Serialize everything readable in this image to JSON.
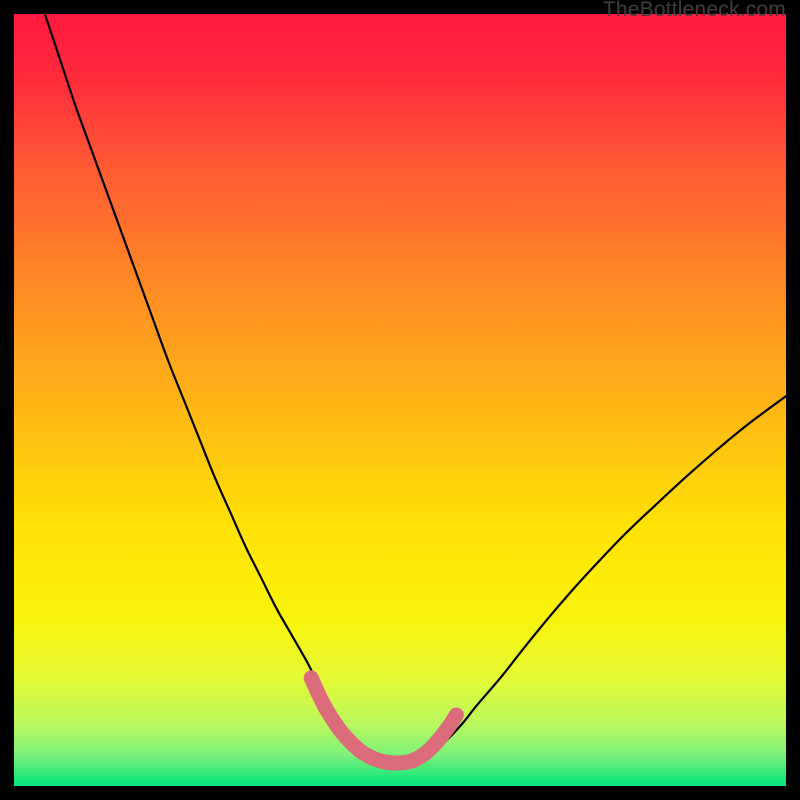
{
  "attribution": "TheBottleneck.com",
  "colors": {
    "black": "#000000",
    "curve": "#000000",
    "pink_highlight": "#dc6b7c",
    "gradient_top": "#ff193f",
    "gradient_mid": "#ffd400",
    "gradient_bot": "#00e57a"
  },
  "chart_data": {
    "type": "line",
    "title": "",
    "xlabel": "",
    "ylabel": "",
    "xlim": [
      0,
      100
    ],
    "ylim": [
      0,
      100
    ],
    "series": [
      {
        "name": "bottleneck-curve",
        "x": [
          4,
          6,
          8,
          10,
          12,
          14,
          16,
          18,
          20,
          22,
          24,
          26,
          28,
          30,
          32,
          34,
          36,
          38,
          39.5,
          41,
          42.5,
          44,
          45.5,
          47,
          48.5,
          50,
          52,
          54,
          56,
          58,
          60,
          63,
          66,
          69,
          72,
          75,
          79,
          83,
          87,
          91,
          95,
          100
        ],
        "y": [
          100,
          94,
          88,
          82.5,
          77,
          71.5,
          66,
          60.5,
          55,
          50,
          45,
          40,
          35.5,
          31,
          27,
          23,
          19.5,
          16,
          13,
          10.5,
          8.2,
          6.2,
          4.7,
          3.5,
          3,
          3,
          3.3,
          4.3,
          5.9,
          8,
          10.5,
          14,
          17.8,
          21.5,
          25,
          28.3,
          32.5,
          36.3,
          40,
          43.5,
          46.8,
          50.5
        ]
      }
    ],
    "annotations": [
      {
        "name": "pink-trough-highlight",
        "type": "segment",
        "x": [
          38.5,
          39.3,
          40.1,
          40.9,
          41.7,
          42.5,
          43.3,
          44.1,
          44.9,
          45.7,
          46.5,
          47.3,
          48.1,
          49,
          50,
          51,
          51.9,
          52.8,
          53.7,
          54.6,
          55.5,
          56.4,
          57.3
        ],
        "y": [
          14,
          12.2,
          10.6,
          9.2,
          8,
          6.9,
          6,
          5.2,
          4.5,
          4,
          3.6,
          3.3,
          3.1,
          3,
          3,
          3.1,
          3.4,
          3.9,
          4.6,
          5.5,
          6.6,
          7.8,
          9.2
        ]
      }
    ]
  }
}
